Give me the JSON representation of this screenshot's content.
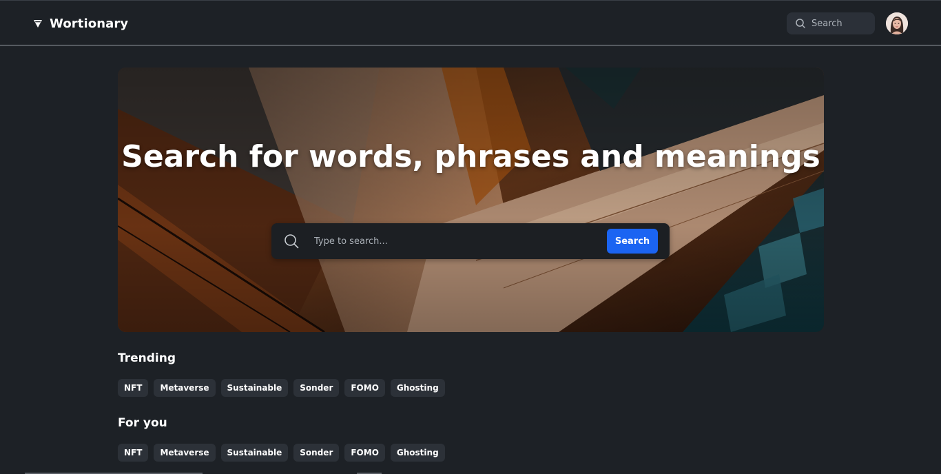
{
  "header": {
    "brand_name": "Wortionary",
    "search_label": "Search"
  },
  "hero": {
    "title": "Search for words, phrases and meanings",
    "search_placeholder": "Type to search...",
    "search_button": "Search"
  },
  "trending": {
    "title": "Trending",
    "tags": [
      "NFT",
      "Metaverse",
      "Sustainable",
      "Sonder",
      "FOMO",
      "Ghosting"
    ]
  },
  "for_you": {
    "title": "For you",
    "tags": [
      "NFT",
      "Metaverse",
      "Sustainable",
      "Sonder",
      "FOMO",
      "Ghosting"
    ]
  },
  "colors": {
    "background": "#1d2126",
    "accent": "#1b64f2",
    "tag_bg": "#2c3138"
  }
}
